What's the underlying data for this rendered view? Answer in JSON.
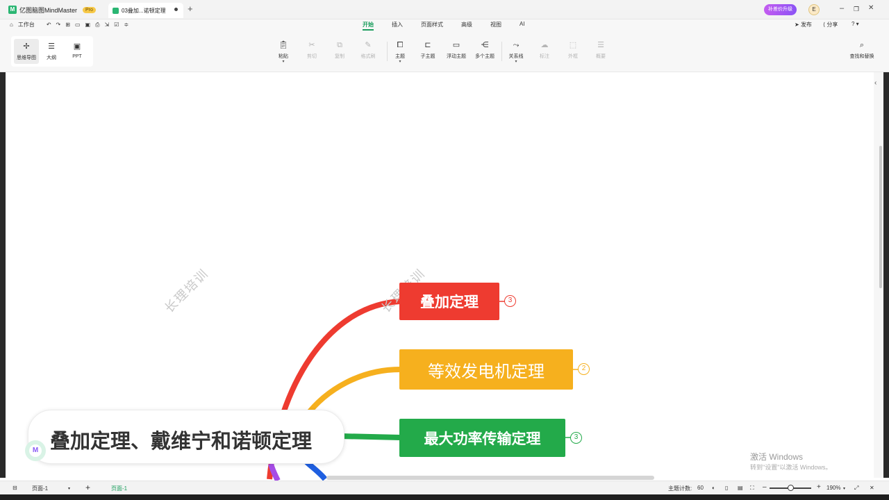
{
  "titlebar": {
    "app_name": "亿图脑图MindMaster",
    "pro_badge": "Pro",
    "doc_tab": "03叠加...诺顿定理",
    "new_tab": "+",
    "upgrade": "补差价升级",
    "user_initial": "E",
    "minimize": "–",
    "restore": "❐",
    "close": "✕"
  },
  "menu": {
    "workbench": "工作台",
    "tabs": [
      "开始",
      "插入",
      "页面样式",
      "高级",
      "视图",
      "AI"
    ],
    "active_tab": "开始",
    "publish": "发布",
    "share": "分享",
    "help": "?"
  },
  "toolbar": {
    "views": [
      {
        "label": "思维导图",
        "icon": "mindmap-icon"
      },
      {
        "label": "大纲",
        "icon": "outline-icon"
      },
      {
        "label": "PPT",
        "icon": "ppt-icon"
      }
    ],
    "buttons": [
      {
        "label": "粘贴",
        "enabled": true
      },
      {
        "label": "剪切",
        "enabled": false
      },
      {
        "label": "复制",
        "enabled": false
      },
      {
        "label": "格式刷",
        "enabled": false
      },
      {
        "label": "主题",
        "enabled": true
      },
      {
        "label": "子主题",
        "enabled": true
      },
      {
        "label": "浮动主题",
        "enabled": true
      },
      {
        "label": "多个主题",
        "enabled": true
      },
      {
        "label": "关系线",
        "enabled": true
      },
      {
        "label": "标注",
        "enabled": false
      },
      {
        "label": "外框",
        "enabled": false
      },
      {
        "label": "概要",
        "enabled": false
      }
    ],
    "find_replace": "查找和替换"
  },
  "canvas": {
    "watermark": "长理培训",
    "central_topic": "叠加定理、戴维宁和诺顿定理",
    "topics": [
      {
        "label": "叠加定理",
        "count": "3",
        "color": "#ee3b30"
      },
      {
        "label": "等效发电机定理",
        "count": "2",
        "color": "#f6b01e"
      },
      {
        "label": "最大功率传输定理",
        "count": "3",
        "color": "#23aa4a"
      }
    ],
    "branch_colors": {
      "purple": "#a64de6",
      "blue": "#1f5fe0"
    }
  },
  "activation": {
    "line1": "激活 Windows",
    "line2": "转到\"设置\"以激活 Windows。"
  },
  "statusbar": {
    "page_select": "页面-1",
    "add_page": "+",
    "page_tab": "页面-1",
    "topic_count_label": "主题计数:",
    "topic_count": "60",
    "zoom_out": "–",
    "zoom_in": "+",
    "zoom_value": "190%",
    "zoom_fraction": 0.55
  }
}
